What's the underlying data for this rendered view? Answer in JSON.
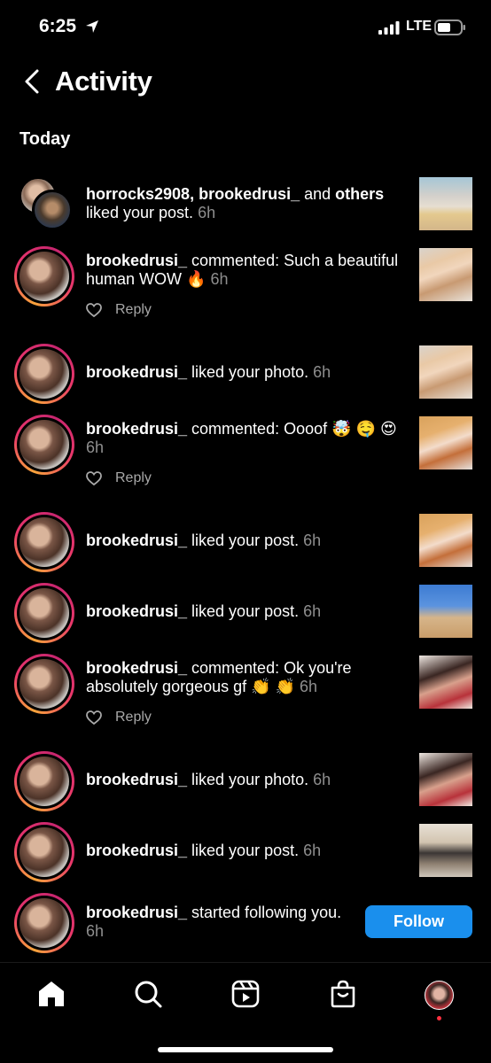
{
  "status_bar": {
    "time": "6:25",
    "network": "LTE"
  },
  "header": {
    "title": "Activity"
  },
  "section": {
    "title": "Today"
  },
  "activities": [
    {
      "user": "horrocks2908, brookedrusi_",
      "mid": " and ",
      "user2": "others",
      "action": " liked your post.",
      "time": "6h",
      "thumb": "beach"
    },
    {
      "user": "brookedrusi_",
      "action": " commented: Such a beautiful human WOW 🔥",
      "time": "6h",
      "reply": "Reply",
      "thumb": "blonde"
    },
    {
      "user": "brookedrusi_",
      "action": " liked your photo.",
      "time": "6h",
      "thumb": "blonde"
    },
    {
      "user": "brookedrusi_",
      "action": " commented: Oooof 🤯 🤤 😍",
      "time": "6h",
      "reply": "Reply",
      "thumb": "orange"
    },
    {
      "user": "brookedrusi_",
      "action": " liked your post.",
      "time": "6h",
      "thumb": "orange"
    },
    {
      "user": "brookedrusi_",
      "action": " liked your post.",
      "time": "6h",
      "thumb": "sand"
    },
    {
      "user": "brookedrusi_",
      "action": " commented: Ok you're absolutely gorgeous gf 👏 👏",
      "time": "6h",
      "reply": "Reply",
      "thumb": "dark"
    },
    {
      "user": "brookedrusi_",
      "action": " liked your photo.",
      "time": "6h",
      "thumb": "dark"
    },
    {
      "user": "brookedrusi_",
      "action": " liked your post.",
      "time": "6h",
      "thumb": "gym"
    },
    {
      "user": "brookedrusi_",
      "action": " started following you.",
      "time": "6h",
      "button": "Follow"
    }
  ],
  "tabs": [
    "home",
    "search",
    "reels",
    "shop",
    "profile"
  ]
}
